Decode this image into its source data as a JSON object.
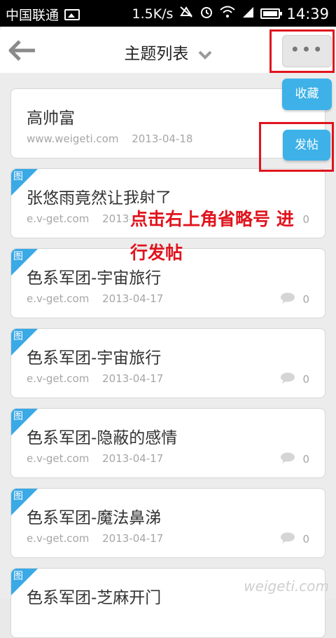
{
  "status_bar": {
    "carrier": "中国联通",
    "speed": "1.5K/s",
    "time": "14:39"
  },
  "header": {
    "title": "主题列表",
    "more_label": "•••"
  },
  "actions": {
    "favorite_label": "收藏",
    "post_label": "发帖"
  },
  "annotation": {
    "line1": "点击右上角省略号  进",
    "line2": "行发帖"
  },
  "tag_label": "图",
  "topics": [
    {
      "title": "高帅富",
      "source": "www.weigeti.com",
      "date": "2013-04-18",
      "has_image": false,
      "comments": ""
    },
    {
      "title": "张悠雨竟然让我射了",
      "source": "e.v-get.com",
      "date": "2013-04-17",
      "has_image": true,
      "comments": "0"
    },
    {
      "title": "色系军团-宇宙旅行",
      "source": "e.v-get.com",
      "date": "2013-04-17",
      "has_image": true,
      "comments": "0"
    },
    {
      "title": "色系军团-宇宙旅行",
      "source": "e.v-get.com",
      "date": "2013-04-17",
      "has_image": true,
      "comments": "0"
    },
    {
      "title": "色系军团-隐蔽的感情",
      "source": "e.v-get.com",
      "date": "2013-04-17",
      "has_image": true,
      "comments": "0"
    },
    {
      "title": "色系军团-魔法鼻涕",
      "source": "e.v-get.com",
      "date": "2013-04-17",
      "has_image": true,
      "comments": "0"
    },
    {
      "title": "色系军团-芝麻开门",
      "source": "",
      "date": "",
      "has_image": true,
      "comments": ""
    }
  ],
  "watermark": "weigeti.com"
}
